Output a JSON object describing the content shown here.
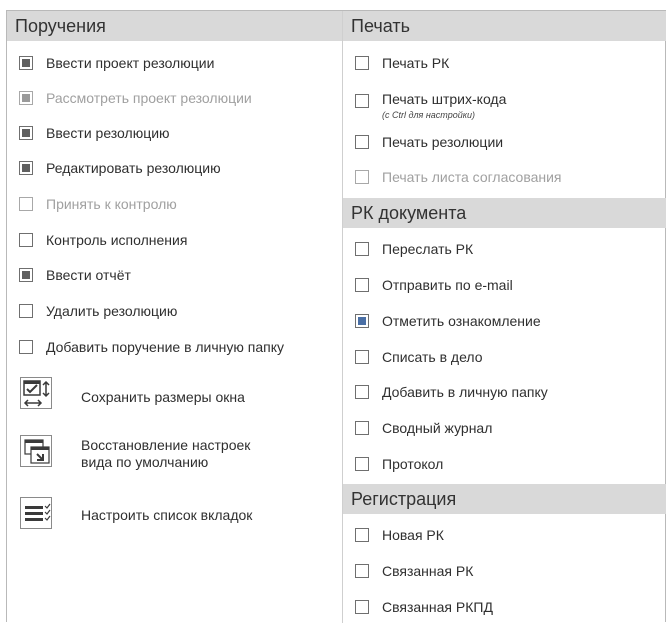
{
  "assignments": {
    "title": "Поручения",
    "items": [
      {
        "label": "Ввести проект резолюции",
        "checked": true,
        "disabled": false
      },
      {
        "label": "Рассмотреть проект резолюции",
        "checked": true,
        "disabled": true
      },
      {
        "label": "Ввести резолюцию",
        "checked": true,
        "disabled": false
      },
      {
        "label": "Редактировать резолюцию",
        "checked": true,
        "disabled": false
      },
      {
        "label": "Принять к контролю",
        "checked": false,
        "disabled": true
      },
      {
        "label": "Контроль исполнения",
        "checked": false,
        "disabled": false
      },
      {
        "label": "Ввести отчёт",
        "checked": true,
        "disabled": false
      },
      {
        "label": "Удалить резолюцию",
        "checked": false,
        "disabled": false
      },
      {
        "label": "Добавить поручение в личную папку",
        "checked": false,
        "disabled": false
      }
    ]
  },
  "tools": {
    "save_size": {
      "label": "Сохранить размеры окна",
      "icon": "save-window-size-icon"
    },
    "restore_defaults": {
      "label_line1": "Восстановление настроек",
      "label_line2": "вида по умолчанию",
      "icon": "restore-defaults-icon"
    },
    "configure_tabs": {
      "label": "Настроить список вкладок",
      "icon": "configure-tabs-icon"
    }
  },
  "print": {
    "title": "Печать",
    "items": [
      {
        "label": "Печать РК",
        "checked": false,
        "disabled": false
      },
      {
        "label": "Печать штрих-кода",
        "hint": "(с Ctrl для настройки)",
        "checked": false,
        "disabled": false
      },
      {
        "label": "Печать резолюции",
        "checked": false,
        "disabled": false
      },
      {
        "label": "Печать листа согласования",
        "checked": false,
        "disabled": true
      }
    ]
  },
  "rk_document": {
    "title": "РК документа",
    "items": [
      {
        "label": "Переслать РК",
        "checked": false
      },
      {
        "label": "Отправить по e-mail",
        "checked": false
      },
      {
        "label": "Отметить ознакомление",
        "checked": true
      },
      {
        "label": "Списать в дело",
        "checked": false
      },
      {
        "label": "Добавить в личную папку",
        "checked": false
      },
      {
        "label": "Сводный журнал",
        "checked": false
      },
      {
        "label": "Протокол",
        "checked": false
      }
    ]
  },
  "registration": {
    "title": "Регистрация",
    "items": [
      {
        "label": "Новая РК",
        "checked": false
      },
      {
        "label": "Связанная РК",
        "checked": false
      },
      {
        "label": "Связанная РКПД",
        "checked": false
      }
    ]
  },
  "colors": {
    "header_bg": "#d9d9d9",
    "checked_fill": "#606060",
    "checked_accent": "#4a6fa5",
    "disabled_text": "#a0a0a0"
  }
}
